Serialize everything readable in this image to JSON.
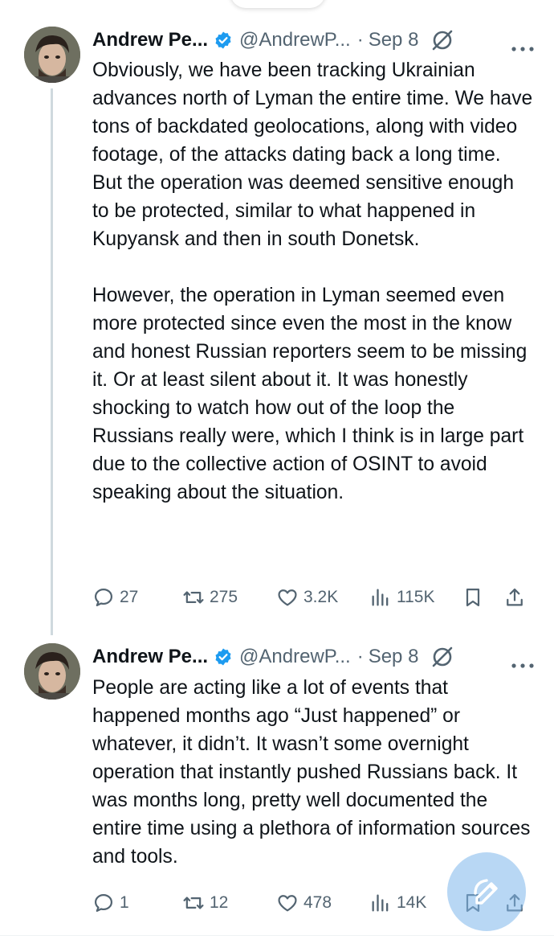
{
  "tweets": [
    {
      "author_name": "Andrew Pe...",
      "handle": "@AndrewP...",
      "separator": "·",
      "date": "Sep 8",
      "paragraphs": [
        "Obviously, we have been tracking Ukrainian advances north of Lyman the entire time. We have tons of backdated geolocations, along with video footage, of the attacks dating back a long time. But the operation was deemed sensitive enough to be protected, similar to what happened in Kupyansk and then in south Donetsk.",
        "However, the operation in Lyman seemed even more protected since even the most in the know and honest Russian reporters seem to be missing it. Or at least silent about it. It was honestly shocking to watch how out of the loop the Russians really were, which I think is in large part due to the collective action of OSINT to avoid speaking about the situation."
      ],
      "replies": "27",
      "reposts": "275",
      "likes": "3.2K",
      "views": "115K"
    },
    {
      "author_name": "Andrew Pe...",
      "handle": "@AndrewP...",
      "separator": "·",
      "date": "Sep 8",
      "paragraphs": [
        "People are acting like a lot of events that happened months ago “Just happened” or whatever, it didn’t. It wasn’t some overnight operation that instantly pushed Russians back. It was months long, pretty well documented the entire time using a plethora of information sources and tools."
      ],
      "replies": "1",
      "reposts": "12",
      "likes": "478",
      "views": "14K"
    }
  ],
  "icons": {
    "verified": "verified-badge-icon",
    "grok": "grok-icon",
    "more": "more-icon",
    "reply": "reply-icon",
    "repost": "repost-icon",
    "like": "like-icon",
    "views": "views-icon",
    "bookmark": "bookmark-icon",
    "share": "share-icon",
    "compose": "compose-icon"
  },
  "colors": {
    "text": "#0f1419",
    "secondary": "#536471",
    "verified": "#1d9bf0",
    "thread_line": "#cfd9de",
    "fab": "#7db7eb"
  }
}
